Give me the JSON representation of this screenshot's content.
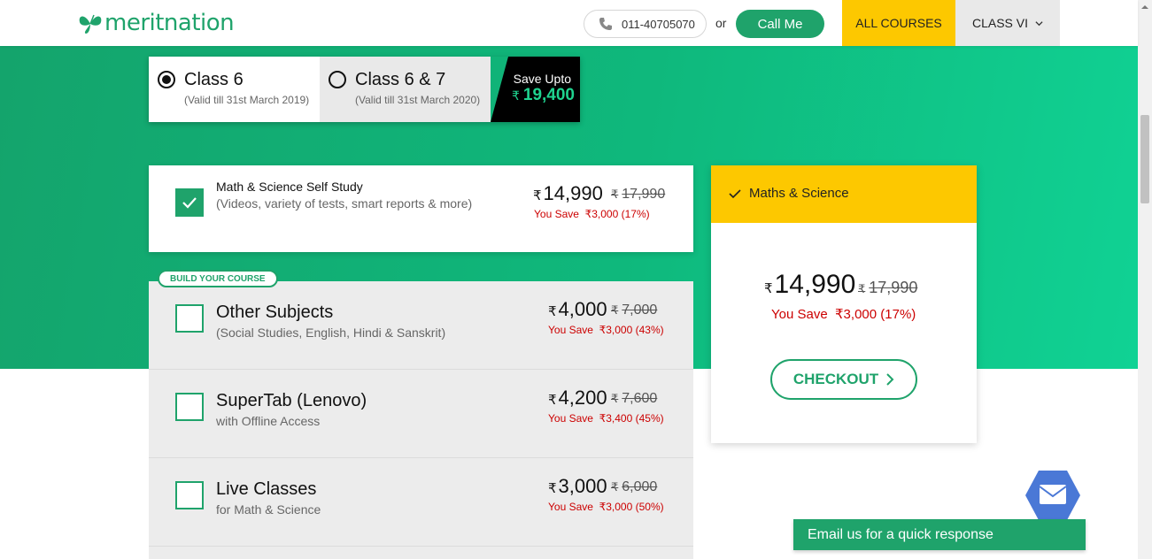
{
  "header": {
    "logo_text": "meritnation",
    "phone": "011-40705070",
    "or_text": "or",
    "call_label": "Call Me",
    "all_courses_label": "ALL COURSES",
    "class_dropdown_label": "CLASS VI"
  },
  "class_options": [
    {
      "name": "Class 6",
      "validity": "(Valid till 31st March 2019)",
      "selected": true
    },
    {
      "name": "Class 6 & 7",
      "validity": "(Valid till 31st March 2020)",
      "selected": false
    }
  ],
  "save_banner": {
    "label": "Save Upto",
    "currency": "₹",
    "amount": "19,400"
  },
  "main_item": {
    "title": "Math & Science Self Study",
    "subtitle": "(Videos, variety of tests, smart reports & more)",
    "currency": "₹",
    "price": "14,990",
    "old_price": "17,990",
    "you_save": "You Save",
    "save_amount": "₹3,000 (17%)",
    "checked": true
  },
  "build_badge": "BUILD YOUR COURSE",
  "addons": [
    {
      "title": "Other Subjects",
      "subtitle": "(Social Studies, English, Hindi & Sanskrit)",
      "currency": "₹",
      "price": "4,000",
      "old_price": "7,000",
      "you_save": "You Save",
      "save_amount": "₹3,000 (43%)"
    },
    {
      "title": "SuperTab (Lenovo)",
      "subtitle": "with Offline Access",
      "currency": "₹",
      "price": "4,200",
      "old_price": "7,600",
      "you_save": "You Save",
      "save_amount": "₹3,400 (45%)"
    },
    {
      "title": "Live Classes",
      "subtitle": "for Math & Science",
      "currency": "₹",
      "price": "3,000",
      "old_price": "6,000",
      "you_save": "You Save",
      "save_amount": "₹3,000 (50%)"
    }
  ],
  "summary": {
    "selection": "Maths & Science",
    "currency": "₹",
    "price": "14,990",
    "old_price": "17,990",
    "you_save": "You Save",
    "save_amount": "₹3,000 (17%)",
    "checkout_label": "CHECKOUT"
  },
  "email_widget": {
    "label": "Email us for a quick response"
  },
  "colors": {
    "brand_green": "#1fa36b",
    "accent_yellow": "#fdc800",
    "save_red": "#c00000"
  }
}
